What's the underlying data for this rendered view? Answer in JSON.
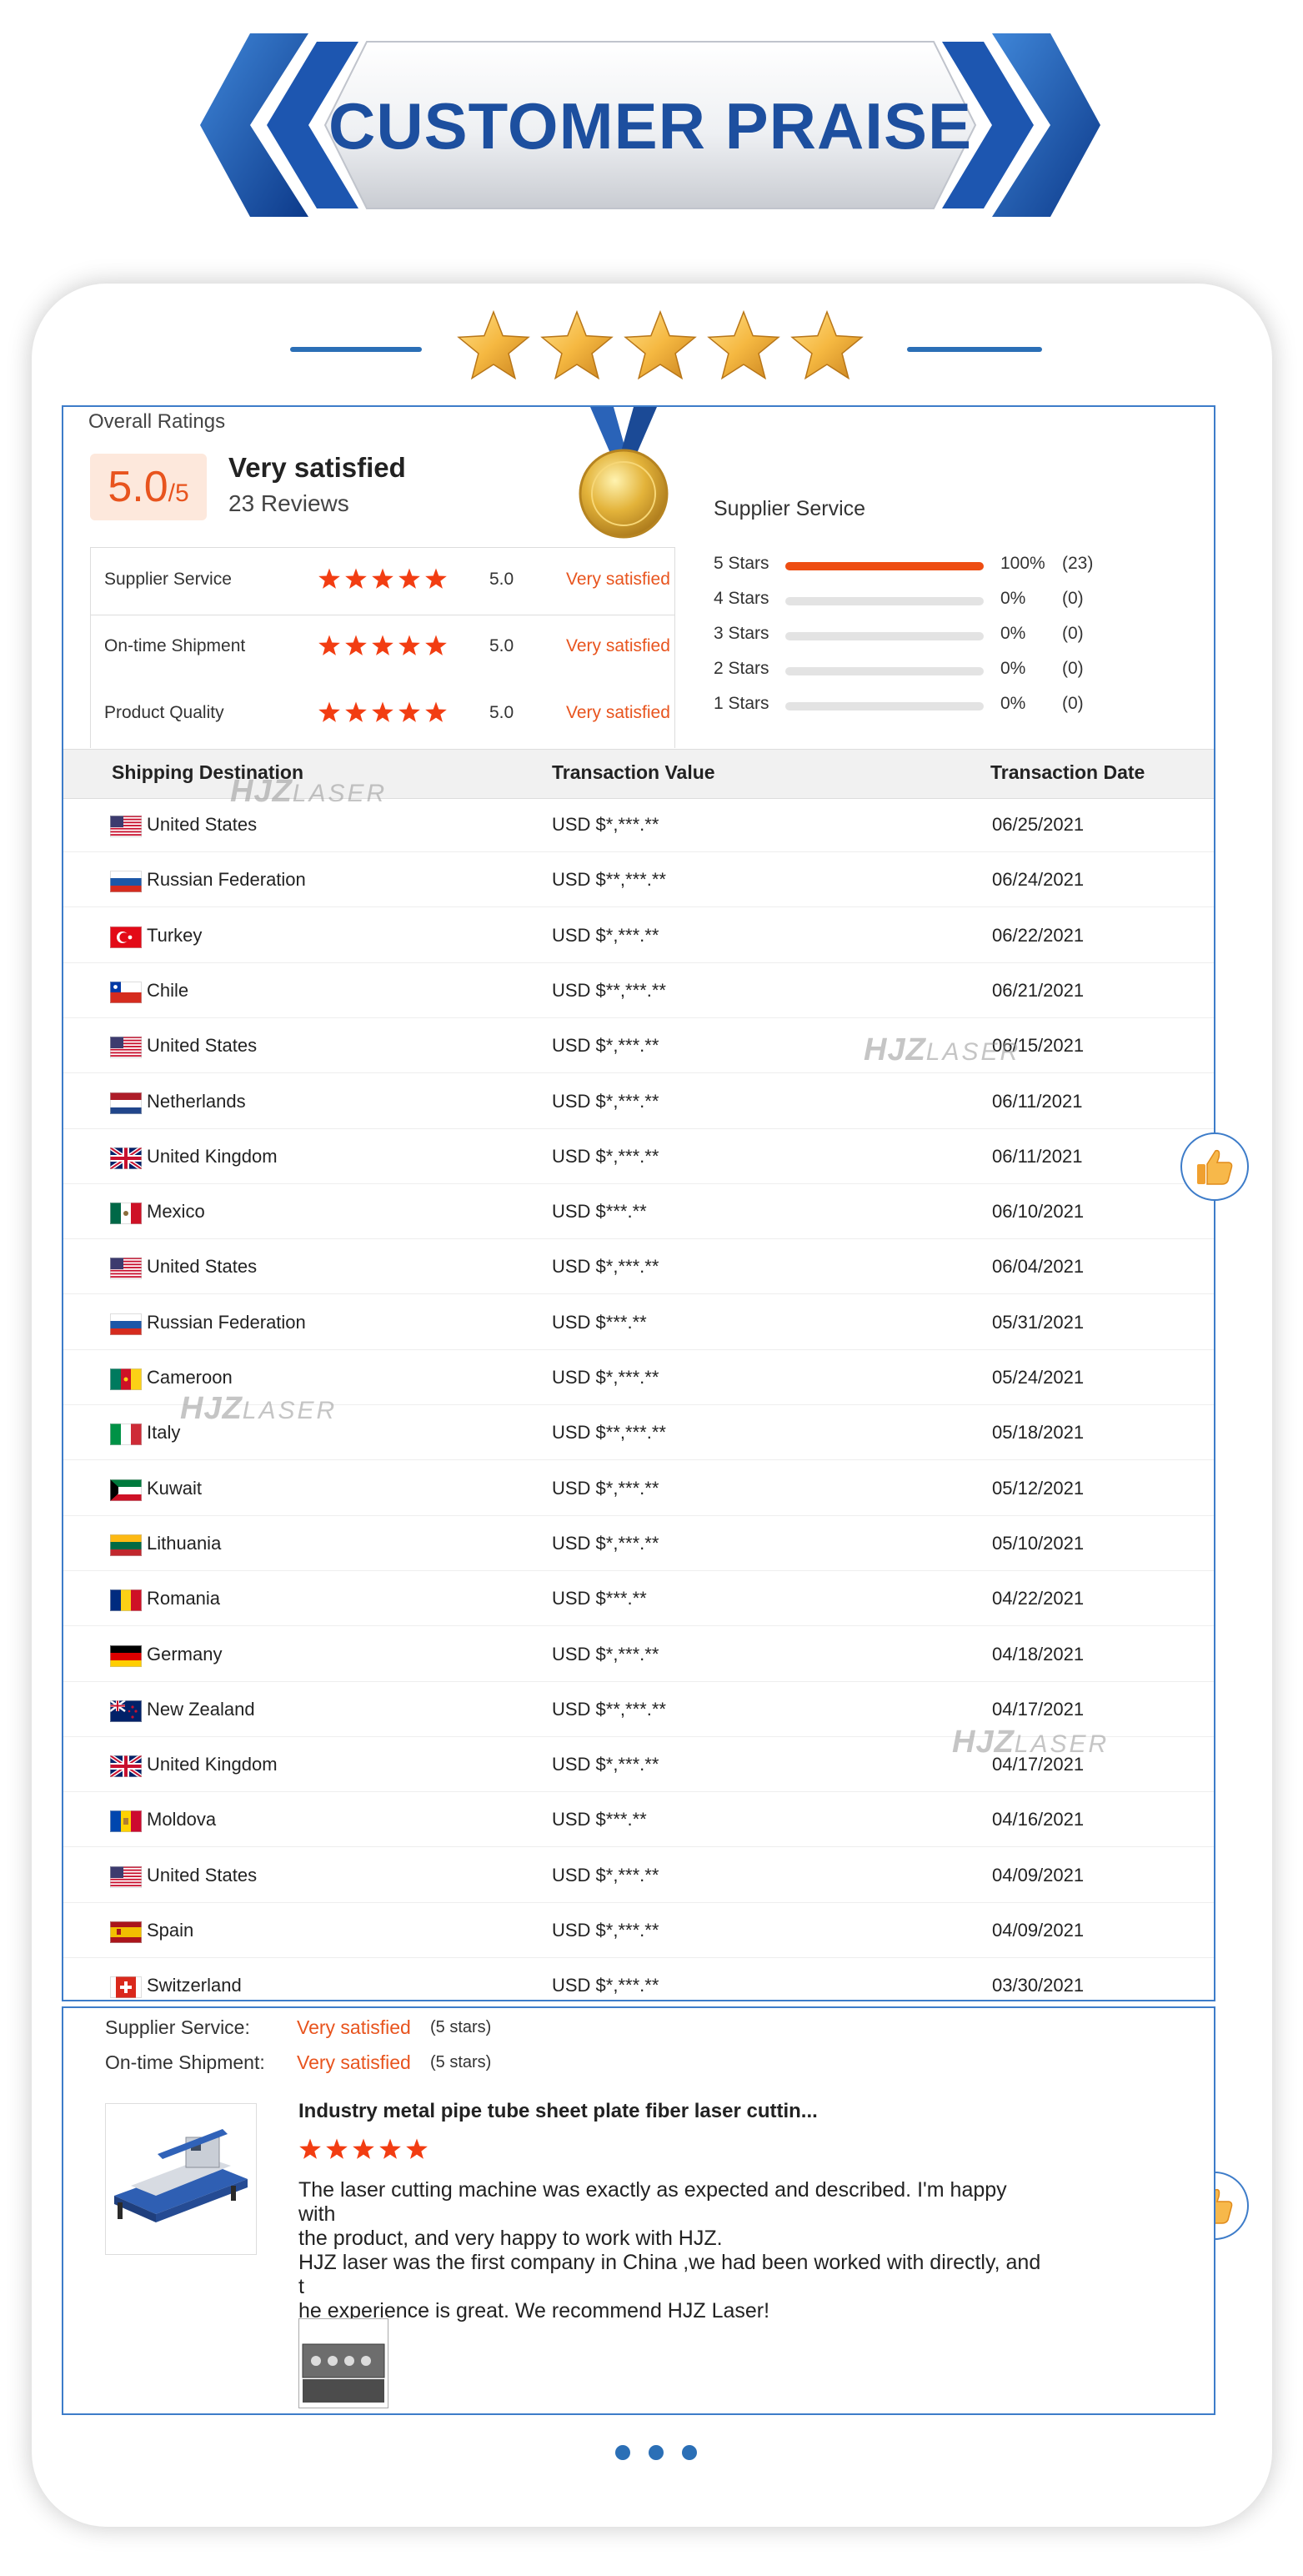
{
  "banner": {
    "title": "CUSTOMER PRAISE"
  },
  "overall": {
    "label": "Overall Ratings",
    "score": "5.0",
    "score_suffix": "/5",
    "headline": "Very satisfied",
    "reviews": "23 Reviews"
  },
  "ratings": [
    {
      "label": "Supplier Service",
      "score": "5.0",
      "text": "Very satisfied"
    },
    {
      "label": "On-time Shipment",
      "score": "5.0",
      "text": "Very satisfied"
    },
    {
      "label": "Product Quality",
      "score": "5.0",
      "text": "Very satisfied"
    }
  ],
  "supplier_service": {
    "title": "Supplier Service",
    "bars": [
      {
        "label": "5 Stars",
        "percent": "100%",
        "count": "(23)",
        "fill": 1.0
      },
      {
        "label": "4 Stars",
        "percent": "0%",
        "count": "(0)",
        "fill": 0
      },
      {
        "label": "3 Stars",
        "percent": "0%",
        "count": "(0)",
        "fill": 0
      },
      {
        "label": "2 Stars",
        "percent": "0%",
        "count": "(0)",
        "fill": 0
      },
      {
        "label": "1 Stars",
        "percent": "0%",
        "count": "(0)",
        "fill": 0
      }
    ]
  },
  "table": {
    "headers": [
      "Shipping Destination",
      "Transaction Value",
      "Transaction Date"
    ],
    "rows": [
      {
        "country": "United States",
        "flag": "us",
        "value": "USD $*,***.**",
        "date": "06/25/2021"
      },
      {
        "country": "Russian Federation",
        "flag": "ru",
        "value": "USD $**,***.**",
        "date": "06/24/2021"
      },
      {
        "country": "Turkey",
        "flag": "tr",
        "value": "USD $*,***.**",
        "date": "06/22/2021"
      },
      {
        "country": "Chile",
        "flag": "cl",
        "value": "USD $**,***.**",
        "date": "06/21/2021"
      },
      {
        "country": "United States",
        "flag": "us",
        "value": "USD $*,***.**",
        "date": "06/15/2021"
      },
      {
        "country": "Netherlands",
        "flag": "nl",
        "value": "USD $*,***.**",
        "date": "06/11/2021"
      },
      {
        "country": "United Kingdom",
        "flag": "gb",
        "value": "USD $*,***.**",
        "date": "06/11/2021"
      },
      {
        "country": "Mexico",
        "flag": "mx",
        "value": "USD $***.**",
        "date": "06/10/2021"
      },
      {
        "country": "United States",
        "flag": "us",
        "value": "USD $*,***.**",
        "date": "06/04/2021"
      },
      {
        "country": "Russian Federation",
        "flag": "ru",
        "value": "USD $***.**",
        "date": "05/31/2021"
      },
      {
        "country": "Cameroon",
        "flag": "cm",
        "value": "USD $*,***.**",
        "date": "05/24/2021"
      },
      {
        "country": "Italy",
        "flag": "it",
        "value": "USD $**,***.**",
        "date": "05/18/2021"
      },
      {
        "country": "Kuwait",
        "flag": "kw",
        "value": "USD $*,***.**",
        "date": "05/12/2021"
      },
      {
        "country": "Lithuania",
        "flag": "lt",
        "value": "USD $*,***.**",
        "date": "05/10/2021"
      },
      {
        "country": "Romania",
        "flag": "ro",
        "value": "USD $***.**",
        "date": "04/22/2021"
      },
      {
        "country": "Germany",
        "flag": "de",
        "value": "USD $*,***.**",
        "date": "04/18/2021"
      },
      {
        "country": "New Zealand",
        "flag": "nz",
        "value": "USD $**,***.**",
        "date": "04/17/2021"
      },
      {
        "country": "United Kingdom",
        "flag": "gb",
        "value": "USD $*,***.**",
        "date": "04/17/2021"
      },
      {
        "country": "Moldova",
        "flag": "md",
        "value": "USD $***.**",
        "date": "04/16/2021"
      },
      {
        "country": "United States",
        "flag": "us",
        "value": "USD $*,***.**",
        "date": "04/09/2021"
      },
      {
        "country": "Spain",
        "flag": "es",
        "value": "USD $*,***.**",
        "date": "04/09/2021"
      },
      {
        "country": "Switzerland",
        "flag": "ch",
        "value": "USD $*,***.**",
        "date": "03/30/2021"
      }
    ]
  },
  "watermark": {
    "brand": "HJZ",
    "word": "LASER"
  },
  "review": {
    "supplier_label": "Supplier Service:",
    "supplier_value": "Very satisfied",
    "supplier_stars": "(5 stars)",
    "shipment_label": "On-time Shipment:",
    "shipment_value": "Very satisfied",
    "shipment_stars": "(5 stars)",
    "product_title": "Industry metal pipe tube sheet plate fiber laser cuttin...",
    "text_lines": [
      "The laser cutting machine was exactly as expected and described. I'm happy with",
      "the product, and very happy to work with HJZ.",
      "HJZ laser was the first company in China ,we had been worked with directly, and t",
      "he experience is great.  We recommend HJZ Laser!"
    ]
  },
  "colors": {
    "accent_blue": "#2b6fb6",
    "orange": "#e8541e",
    "star_gold": "#f5b841"
  },
  "icons": [
    "star-icon",
    "medal-icon",
    "thumbs-up-icon",
    "flag-icon"
  ]
}
